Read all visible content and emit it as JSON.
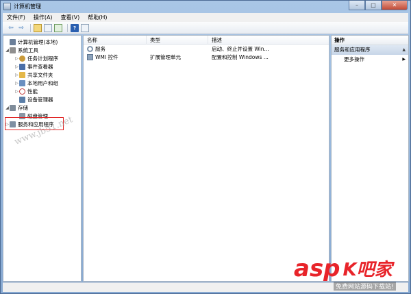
{
  "window": {
    "title": "计算机管理",
    "min": "–",
    "max": "□",
    "close": "✕"
  },
  "menu": [
    {
      "label": "文件(F)"
    },
    {
      "label": "操作(A)"
    },
    {
      "label": "查看(V)"
    },
    {
      "label": "帮助(H)"
    }
  ],
  "toolbar": {
    "help_label": "?"
  },
  "tree": [
    {
      "label": "计算机管理(本地)",
      "icon": "computer-icon",
      "expander": "",
      "color": "#6b7f99"
    },
    {
      "label": "系统工具",
      "icon": "tools-icon",
      "expander": "◢",
      "color": "#8f8f8f"
    },
    {
      "label": "任务计划程序",
      "icon": "clock-icon",
      "expander": "▷",
      "color": "#c99a3a"
    },
    {
      "label": "事件查看器",
      "icon": "event-viewer-icon",
      "expander": "▷",
      "color": "#4b6fa8"
    },
    {
      "label": "共享文件夹",
      "icon": "shared-folder-icon",
      "expander": "▷",
      "color": "#e4b84a"
    },
    {
      "label": "本地用户和组",
      "icon": "users-icon",
      "expander": "▷",
      "color": "#6a8fc0"
    },
    {
      "label": "性能",
      "icon": "performance-icon",
      "expander": "▷",
      "color": "#c23b3b"
    },
    {
      "label": "设备管理器",
      "icon": "device-manager-icon",
      "expander": "",
      "color": "#5b7fa8"
    },
    {
      "label": "存储",
      "icon": "storage-icon",
      "expander": "◢",
      "color": "#7f8c9a"
    },
    {
      "label": "磁盘管理",
      "icon": "disk-icon",
      "expander": "",
      "color": "#8a96a5"
    },
    {
      "label": "服务和应用程序",
      "icon": "services-apps-icon",
      "expander": "▷",
      "color": "#7e8fa2"
    }
  ],
  "list": {
    "columns": [
      "名称",
      "类型",
      "描述"
    ],
    "rows": [
      {
        "name": "服务",
        "type": "",
        "desc": "启动、终止并设置 Win...",
        "icon": "gear-icon"
      },
      {
        "name": "WMI 控件",
        "type": "扩展管理单元",
        "desc": "配置和控制 Windows ...",
        "icon": "wmi-icon"
      }
    ]
  },
  "actions": {
    "header": "操作",
    "section": "服务和应用程序",
    "section_arrow": "▲",
    "item": "更多操作",
    "item_arrow": "▶"
  },
  "watermark": "www.jb51.net",
  "logo": {
    "asp": "asp",
    "cn": "K吧家",
    "sub": "免费网站源码下载站!"
  },
  "colors": {
    "highlight": "#e02020",
    "logo_red": "#e8242a"
  }
}
